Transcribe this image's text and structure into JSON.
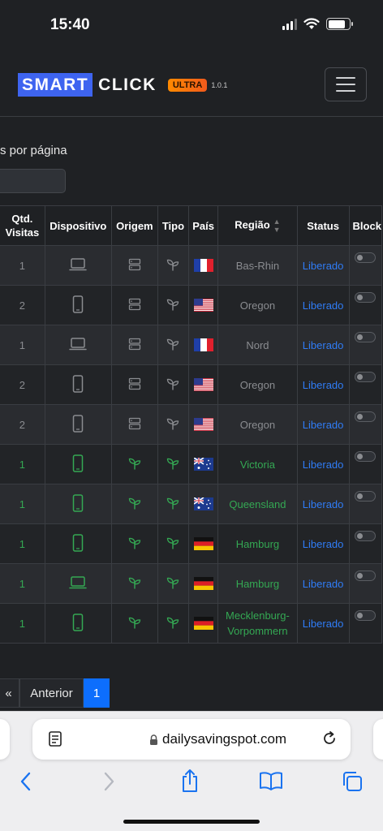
{
  "status_bar": {
    "time": "15:40"
  },
  "navbar": {
    "brand_part1": "SMART",
    "brand_part2": "CLICK",
    "badge": "ULTRA",
    "version": "1.0.1"
  },
  "per_page_label": "s por página",
  "table": {
    "headers": [
      "Qtd.\nVisitas",
      "Dispositivo",
      "Origem",
      "Tipo",
      "País",
      "Região",
      "Status",
      "Block"
    ],
    "rows": [
      {
        "visits": "1",
        "device": "laptop-icon",
        "origin": "server-icon",
        "type": "sprout-icon",
        "country": "france-flag-icon",
        "region": "Bas-Rhin",
        "status": "Liberado",
        "tone": "old"
      },
      {
        "visits": "2",
        "device": "phone-icon",
        "origin": "server-icon",
        "type": "sprout-icon",
        "country": "usa-flag-icon",
        "region": "Oregon",
        "status": "Liberado",
        "tone": "old"
      },
      {
        "visits": "1",
        "device": "laptop-icon",
        "origin": "server-icon",
        "type": "sprout-icon",
        "country": "france-flag-icon",
        "region": "Nord",
        "status": "Liberado",
        "tone": "old"
      },
      {
        "visits": "2",
        "device": "phone-icon",
        "origin": "server-icon",
        "type": "sprout-icon",
        "country": "usa-flag-icon",
        "region": "Oregon",
        "status": "Liberado",
        "tone": "old"
      },
      {
        "visits": "2",
        "device": "phone-icon",
        "origin": "server-icon",
        "type": "sprout-icon",
        "country": "usa-flag-icon",
        "region": "Oregon",
        "status": "Liberado",
        "tone": "old"
      },
      {
        "visits": "1",
        "device": "phone-icon",
        "origin": "sprout-icon",
        "type": "sprout-icon",
        "country": "australia-flag-icon",
        "region": "Victoria",
        "status": "Liberado",
        "tone": "new"
      },
      {
        "visits": "1",
        "device": "phone-icon",
        "origin": "sprout-icon",
        "type": "sprout-icon",
        "country": "australia-flag-icon",
        "region": "Queensland",
        "status": "Liberado",
        "tone": "new"
      },
      {
        "visits": "1",
        "device": "phone-icon",
        "origin": "sprout-icon",
        "type": "sprout-icon",
        "country": "germany-flag-icon",
        "region": "Hamburg",
        "status": "Liberado",
        "tone": "new"
      },
      {
        "visits": "1",
        "device": "laptop-icon",
        "origin": "sprout-icon",
        "type": "sprout-icon",
        "country": "germany-flag-icon",
        "region": "Hamburg",
        "status": "Liberado",
        "tone": "new"
      },
      {
        "visits": "1",
        "device": "phone-icon",
        "origin": "sprout-icon",
        "type": "sprout-icon",
        "country": "germany-flag-icon",
        "region": "Mecklenburg-\nVorpommern",
        "status": "Liberado",
        "tone": "new"
      }
    ]
  },
  "pagination": {
    "first": "«",
    "prev": "Anterior",
    "current": "1"
  },
  "browser": {
    "url": "dailysavingspot.com"
  },
  "colors": {
    "accent": "#0d6efd",
    "brand": "#3e64f0",
    "green": "#34a853",
    "link": "#2f7cf6"
  }
}
